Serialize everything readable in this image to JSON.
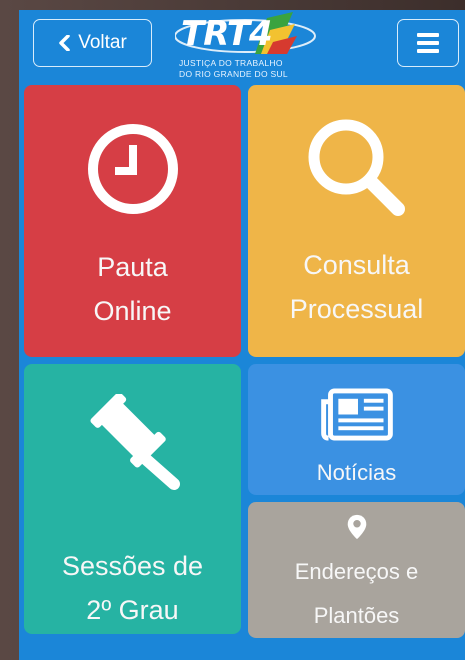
{
  "header": {
    "back_label": "Voltar",
    "back_icon": "chevron-left-icon",
    "menu_icon": "hamburger-menu-icon",
    "logo": {
      "wordmark": "TRT4",
      "line1": "JUSTIÇA DO TRABALHO",
      "line2": "DO RIO GRANDE DO SUL"
    }
  },
  "tiles": {
    "pauta": {
      "line1": "Pauta",
      "line2": "Online",
      "icon": "clock-icon",
      "color": "#d63e45"
    },
    "consulta": {
      "line1": "Consulta",
      "line2": "Processual",
      "icon": "search-icon",
      "color": "#efb548"
    },
    "sessoes": {
      "line1": "Sessões de",
      "line2": "2º Grau",
      "icon": "gavel-icon",
      "color": "#26b3a3"
    },
    "noticias": {
      "line1": "Notícias",
      "icon": "newspaper-icon",
      "color": "#3b91e2"
    },
    "enderecos": {
      "line1": "Endereços e",
      "line2": "Plantões",
      "icon": "map-marker-icon",
      "color": "#a9a49d"
    }
  },
  "colors": {
    "background": "#1b86d8",
    "text": "#f7f7f7"
  }
}
